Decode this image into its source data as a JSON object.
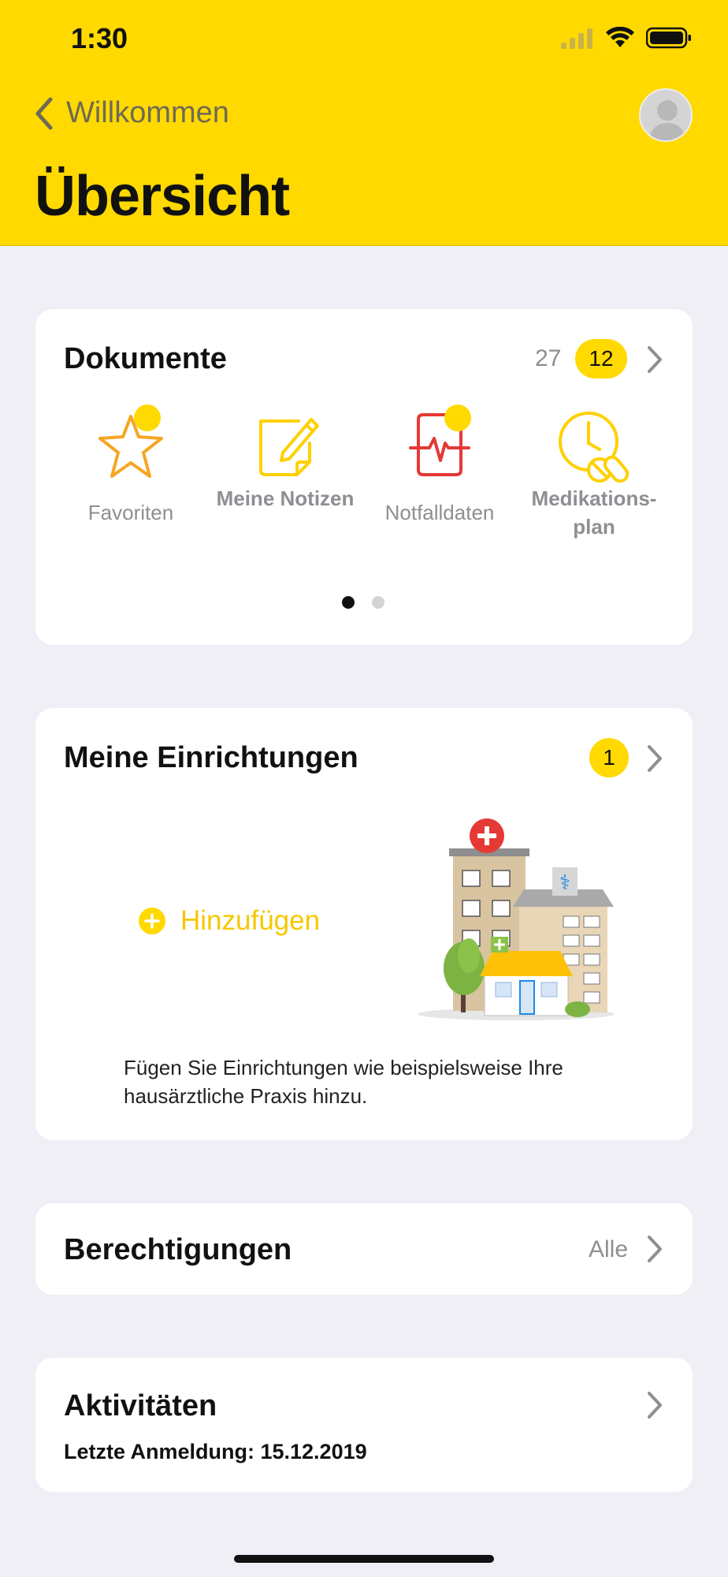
{
  "status": {
    "time": "1:30"
  },
  "nav": {
    "back_label": "Willkommen"
  },
  "page": {
    "title": "Übersicht"
  },
  "documents": {
    "title": "Dokumente",
    "count": "27",
    "badge": "12",
    "items": [
      {
        "label": "Favoriten",
        "icon": "star-icon"
      },
      {
        "label": "Meine Notizen",
        "icon": "note-pencil-icon"
      },
      {
        "label": "Notfalldaten",
        "icon": "emergency-ecg-icon"
      },
      {
        "label": "Medikations-plan",
        "icon": "clock-pills-icon"
      }
    ],
    "page_indicator": {
      "pages": 2,
      "current": 1
    }
  },
  "facilities": {
    "title": "Meine Einrichtungen",
    "badge": "1",
    "add_label": "Hinzufügen",
    "description": "Fügen Sie Einrichtungen wie beispielsweise Ihre hausärztliche Praxis hinzu."
  },
  "permissions": {
    "title": "Berechtigungen",
    "value": "Alle"
  },
  "activities": {
    "title": "Aktivitäten",
    "last_login": "Letzte Anmeldung: 15.12.2019"
  },
  "colors": {
    "accent": "#FFD900",
    "background": "#F0EFF5",
    "card": "#FFFFFF"
  }
}
